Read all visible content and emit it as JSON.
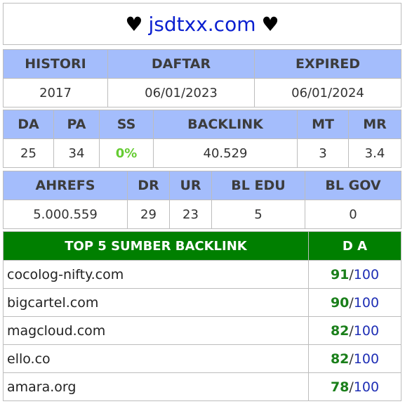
{
  "title": {
    "heart_left": "♥",
    "domain": "jsdtxx.com",
    "heart_right": "♥"
  },
  "history": {
    "headers": [
      "HISTORI",
      "DAFTAR",
      "EXPIRED"
    ],
    "values": [
      "2017",
      "06/01/2023",
      "06/01/2024"
    ]
  },
  "metrics": {
    "headers": [
      "DA",
      "PA",
      "SS",
      "BACKLINK",
      "MT",
      "MR"
    ],
    "values": [
      "25",
      "34",
      "0%",
      "40.529",
      "3",
      "3.4"
    ]
  },
  "ahrefs": {
    "headers": [
      "AHREFS",
      "DR",
      "UR",
      "BL EDU",
      "BL GOV"
    ],
    "values": [
      "5.000.559",
      "29",
      "23",
      "5",
      "0"
    ]
  },
  "backlinks": {
    "header_site": "TOP 5 SUMBER BACKLINK",
    "header_da": "D A",
    "separator": "/",
    "rows": [
      {
        "site": "cocolog-nifty.com",
        "da": "91",
        "max": "100"
      },
      {
        "site": "bigcartel.com",
        "da": "90",
        "max": "100"
      },
      {
        "site": "magcloud.com",
        "da": "82",
        "max": "100"
      },
      {
        "site": "ello.co",
        "da": "82",
        "max": "100"
      },
      {
        "site": "amara.org",
        "da": "78",
        "max": "100"
      }
    ]
  },
  "colors": {
    "header_bg": "#a4bdfc",
    "backlink_header_bg": "#007f00",
    "domain": "#0a1fd0",
    "ss_value": "#66cc33",
    "da_value": "#1a7f1a",
    "da_max": "#1f2fb5"
  }
}
